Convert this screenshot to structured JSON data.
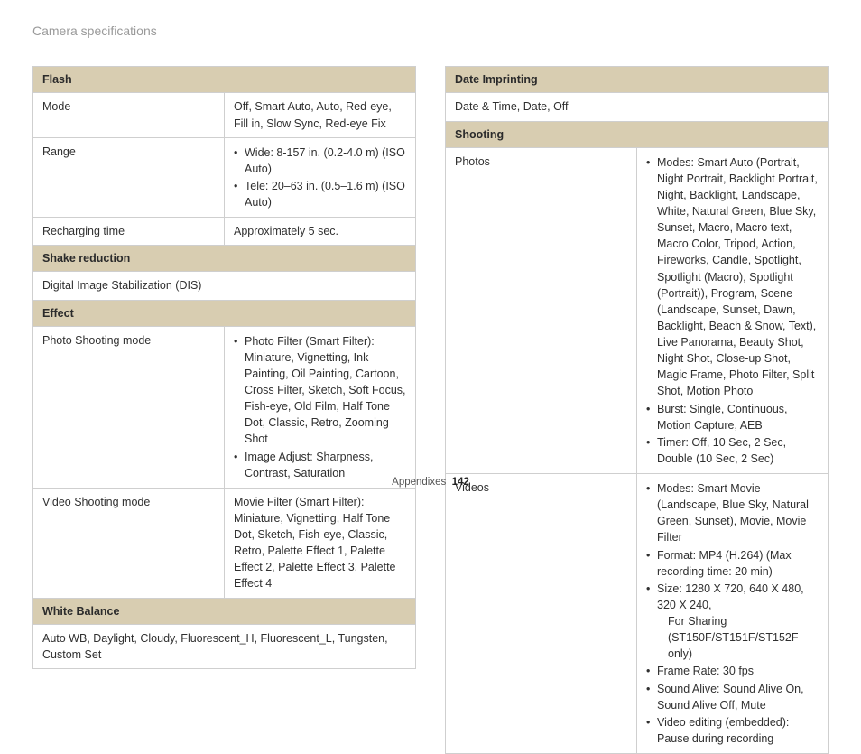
{
  "page_title": "Camera specifications",
  "left": {
    "flash_hdr": "Flash",
    "flash_mode_label": "Mode",
    "flash_mode_value": "Off, Smart Auto, Auto, Red-eye, Fill in, Slow Sync, Red-eye Fix",
    "flash_range_label": "Range",
    "flash_range_b1": "Wide: 8-157 in. (0.2-4.0 m) (ISO Auto)",
    "flash_range_b2": "Tele: 20–63 in. (0.5–1.6 m) (ISO Auto)",
    "flash_recharge_label": "Recharging time",
    "flash_recharge_value": "Approximately 5 sec.",
    "shake_hdr": "Shake reduction",
    "shake_value": "Digital Image Stabilization (DIS)",
    "effect_hdr": "Effect",
    "photo_mode_label": "Photo Shooting mode",
    "photo_mode_b1": "Photo Filter (Smart Filter): Miniature, Vignetting, Ink Painting, Oil Painting, Cartoon, Cross Filter, Sketch, Soft Focus, Fish-eye, Old Film, Half Tone Dot, Classic, Retro, Zooming Shot",
    "photo_mode_b2": "Image Adjust: Sharpness, Contrast, Saturation",
    "video_mode_label": "Video Shooting mode",
    "video_mode_value": "Movie Filter (Smart Filter): Miniature, Vignetting, Half Tone Dot, Sketch, Fish-eye, Classic, Retro, Palette Effect 1, Palette Effect 2, Palette Effect 3, Palette Effect 4",
    "wb_hdr": "White Balance",
    "wb_value": "Auto WB, Daylight, Cloudy, Fluorescent_H, Fluorescent_L, Tungsten, Custom Set"
  },
  "right": {
    "date_hdr": "Date Imprinting",
    "date_value": "Date & Time, Date, Off",
    "shooting_hdr": "Shooting",
    "photos_label": "Photos",
    "photos_b1": "Modes: Smart Auto (Portrait, Night Portrait, Backlight Portrait, Night, Backlight, Landscape, White, Natural Green, Blue Sky, Sunset, Macro, Macro text, Macro Color, Tripod, Action, Fireworks, Candle, Spotlight, Spotlight (Macro), Spotlight (Portrait)), Program, Scene (Landscape, Sunset, Dawn, Backlight, Beach & Snow, Text), Live Panorama, Beauty Shot, Night Shot, Close-up Shot, Magic Frame, Photo Filter, Split Shot, Motion Photo",
    "photos_b2": "Burst: Single, Continuous, Motion Capture, AEB",
    "photos_b3": "Timer: Off, 10 Sec, 2 Sec, Double (10 Sec, 2 Sec)",
    "videos_label": "Videos",
    "videos_b1": "Modes: Smart Movie (Landscape, Blue Sky, Natural Green, Sunset), Movie, Movie Filter",
    "videos_b2": "Format: MP4 (H.264) (Max recording time: 20 min)",
    "videos_b3a": "Size: 1280 X 720, 640 X 480, 320 X 240,",
    "videos_b3b": "For Sharing (ST150F/ST151F/ST152F only)",
    "videos_b4": "Frame Rate: 30 fps",
    "videos_b5": "Sound Alive: Sound Alive On, Sound Alive Off, Mute",
    "videos_b6": "Video editing (embedded): Pause during recording"
  },
  "footer_label": "Appendixes",
  "footer_page": "142"
}
